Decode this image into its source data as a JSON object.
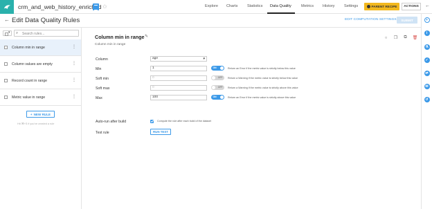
{
  "topbar": {
    "project_title": "crm_and_web_history_enriched",
    "tabs": [
      {
        "label": "Explore"
      },
      {
        "label": "Charts"
      },
      {
        "label": "Statistics"
      },
      {
        "label": "Data Quality"
      },
      {
        "label": "Metrics"
      },
      {
        "label": "History"
      },
      {
        "label": "Settings"
      }
    ],
    "active_tab": "Data Quality",
    "parent_recipe_label": "PARENT RECIPE",
    "actions_label": "ACTIONS"
  },
  "header": {
    "title": "Edit Data Quality Rules",
    "edit_settings_label": "EDIT COMPUTATION SETTINGS",
    "submit_label": "SUBMIT"
  },
  "sidebar": {
    "search_placeholder": "Search rules...",
    "rules": [
      {
        "label": "Column min in range"
      },
      {
        "label": "Column values are empty"
      },
      {
        "label": "Record count in range"
      },
      {
        "label": "Metric value in range"
      }
    ],
    "new_rule_label": "NEW RULE",
    "hint": "Hit ⌘+S if you've created a rule"
  },
  "editor": {
    "title": "Column min in range",
    "subtitle": "Column min in range",
    "fields": {
      "column": {
        "label": "Column",
        "value": "age"
      },
      "min": {
        "label": "Min",
        "value": "1",
        "toggle": "ON",
        "help": "Return an Error if the metric value is strictly below this value"
      },
      "soft_min": {
        "label": "Soft min",
        "placeholder": "0",
        "toggle": "OFF",
        "help": "Return a Warning if the metric value is strictly below this value"
      },
      "soft_max": {
        "label": "Soft max",
        "placeholder": "0",
        "toggle": "OFF",
        "help": "Return a Warning if the metric value is strictly above this value"
      },
      "max": {
        "label": "Max",
        "value": "100",
        "toggle": "ON",
        "help": "Return an Error if the metric value is strictly above this value"
      }
    },
    "auto_run": {
      "label": "Auto-run after build",
      "checked": true,
      "help": "Compute the rule after each build of the dataset"
    },
    "test_rule": {
      "label": "Test rule",
      "button_label": "RUN TEST"
    }
  },
  "colors": {
    "brand": "#2ab1ac",
    "accent": "#3b99e8",
    "parent_recipe": "#f2b81e",
    "active_row": "#e8f1fb"
  },
  "icons": {
    "logo": "bird-logo-icon",
    "dataset": "dataset-icon",
    "favorite": "star-icon",
    "collapse": "arrow-left-icon",
    "rail": [
      "info-icon",
      "lab-icon",
      "check-icon",
      "flow-icon",
      "discussion-icon",
      "history-icon"
    ]
  }
}
